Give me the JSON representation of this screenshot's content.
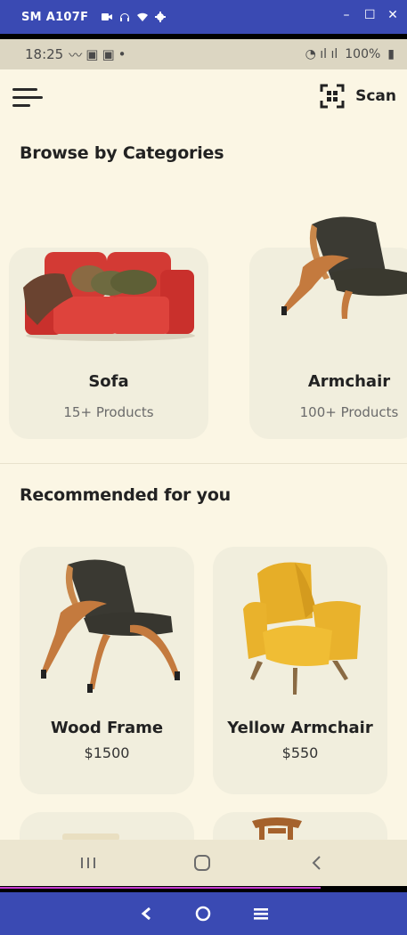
{
  "window": {
    "title": "SM A107F",
    "icons": [
      "video-icon",
      "headphones-icon",
      "wifi-icon",
      "settings-icon"
    ],
    "controls": [
      "minimize-icon",
      "maximize-icon",
      "close-icon"
    ]
  },
  "status_bar": {
    "time": "18:25",
    "battery": "100%"
  },
  "app": {
    "scan_label": "Scan",
    "categories_title": "Browse by Categories",
    "categories": [
      {
        "name": "Sofa",
        "count": "15+ Products"
      },
      {
        "name": "Armchair",
        "count": "100+ Products"
      }
    ],
    "recommended_title": "Recommended for you",
    "recommended": [
      {
        "name": "Wood Frame",
        "price": "$1500"
      },
      {
        "name": "Yellow Armchair",
        "price": "$550"
      }
    ]
  },
  "colors": {
    "background": "#fbf6e4",
    "card": "#f1eedd",
    "host_bar": "#3a4ab3",
    "sofa_red": "#d93b36",
    "chair_yellow": "#e9b22c",
    "wood": "#c9874a"
  }
}
